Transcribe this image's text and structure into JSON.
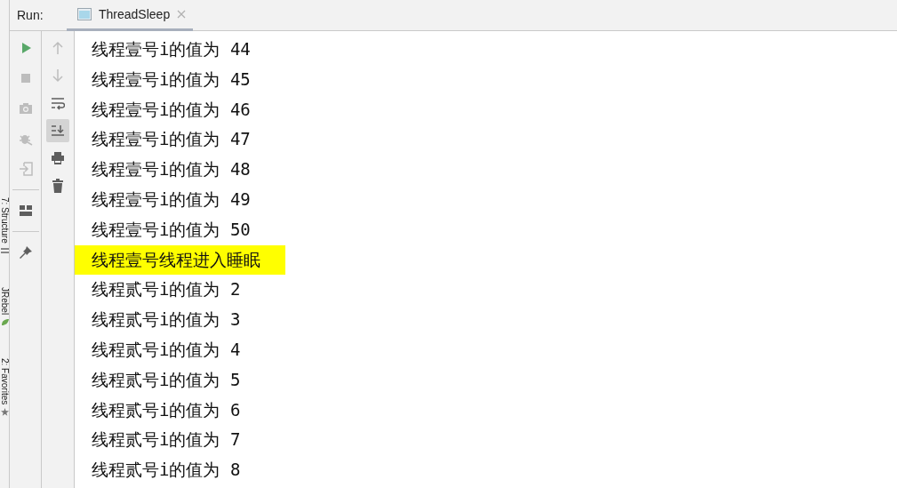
{
  "run_label": "Run:",
  "tab": {
    "title": "ThreadSleep",
    "selected": true
  },
  "side_tabs": [
    {
      "label": "7: Structure",
      "kind": "structure"
    },
    {
      "label": "JRebel",
      "kind": "jrebel"
    },
    {
      "label": "2: Favorites",
      "kind": "favorites"
    }
  ],
  "run_actions": [
    {
      "kind": "run",
      "disabled": false
    },
    {
      "kind": "stop",
      "disabled": true
    },
    {
      "kind": "camera",
      "disabled": true
    },
    {
      "kind": "bug",
      "disabled": true
    },
    {
      "kind": "exit",
      "disabled": true
    },
    {
      "kind": "sep"
    },
    {
      "kind": "layout",
      "disabled": false
    },
    {
      "kind": "sep"
    },
    {
      "kind": "pin",
      "disabled": false
    }
  ],
  "console_actions": [
    {
      "kind": "up",
      "selected": false,
      "disabled": true
    },
    {
      "kind": "down",
      "selected": false,
      "disabled": true
    },
    {
      "kind": "wrap",
      "selected": false,
      "disabled": false
    },
    {
      "kind": "scroll-end",
      "selected": true,
      "disabled": false
    },
    {
      "kind": "print",
      "selected": false,
      "disabled": false
    },
    {
      "kind": "trash",
      "selected": false,
      "disabled": false
    }
  ],
  "console_lines": [
    {
      "text": "线程壹号i的值为 44",
      "highlighted": false
    },
    {
      "text": "线程壹号i的值为 45",
      "highlighted": false
    },
    {
      "text": "线程壹号i的值为 46",
      "highlighted": false
    },
    {
      "text": "线程壹号i的值为 47",
      "highlighted": false
    },
    {
      "text": "线程壹号i的值为 48",
      "highlighted": false
    },
    {
      "text": "线程壹号i的值为 49",
      "highlighted": false
    },
    {
      "text": "线程壹号i的值为 50",
      "highlighted": false
    },
    {
      "text": "线程壹号线程进入睡眠",
      "highlighted": true
    },
    {
      "text": "线程贰号i的值为 2",
      "highlighted": false
    },
    {
      "text": "线程贰号i的值为 3",
      "highlighted": false
    },
    {
      "text": "线程贰号i的值为 4",
      "highlighted": false
    },
    {
      "text": "线程贰号i的值为 5",
      "highlighted": false
    },
    {
      "text": "线程贰号i的值为 6",
      "highlighted": false
    },
    {
      "text": "线程贰号i的值为 7",
      "highlighted": false
    },
    {
      "text": "线程贰号i的值为 8",
      "highlighted": false
    }
  ]
}
